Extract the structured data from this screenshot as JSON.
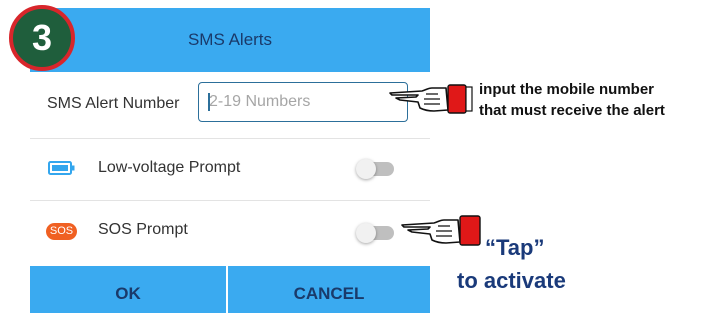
{
  "step": {
    "number": "3"
  },
  "dialog": {
    "title": "SMS Alerts",
    "sms_number": {
      "label": "SMS Alert Number",
      "placeholder": "2-19 Numbers",
      "value": ""
    },
    "low_voltage": {
      "icon": "battery-icon",
      "label": "Low-voltage Prompt",
      "enabled": false
    },
    "sos": {
      "badge": "SOS",
      "label": "SOS Prompt",
      "enabled": false
    },
    "buttons": {
      "ok": "OK",
      "cancel": "CANCEL"
    }
  },
  "annotations": {
    "input_note": [
      "input the mobile number",
      "that must receive the alert"
    ],
    "tap_line1": "“Tap”",
    "tap_line2": "to activate"
  },
  "colors": {
    "header_blue": "#3aaaf0",
    "title_text": "#1a3a6a",
    "sos_orange": "#f06022",
    "battery_blue": "#33a6ee",
    "step_green": "#1f5e3c",
    "step_red": "#d8262b",
    "tap_text": "#1a3a7a"
  }
}
